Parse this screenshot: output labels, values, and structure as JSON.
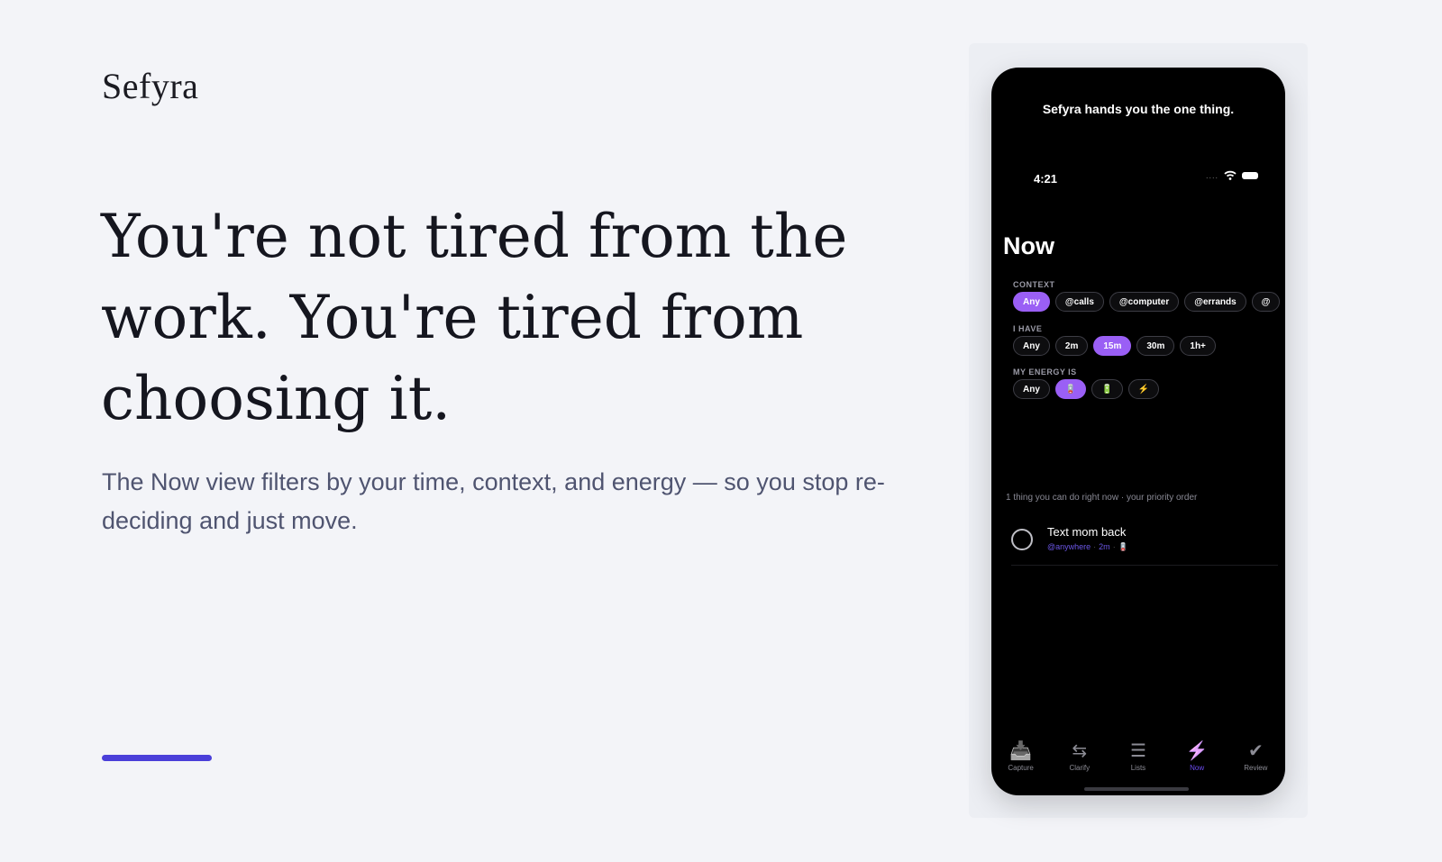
{
  "brand": "Sefyra",
  "headline": "You're not tired from the work. You're tired from choosing it.",
  "subtext": "The Now view filters by your time, context, and energy — so you stop re-deciding and just move.",
  "colors": {
    "accent": "#4a3fd9",
    "chip_active": "#9a5ff5",
    "tab_active": "#6b4bf0",
    "background": "#f3f4f8"
  },
  "phone": {
    "caption": "Sefyra hands you the one thing.",
    "time": "4:21",
    "status_icons": [
      "signal-dots-icon",
      "wifi-icon",
      "battery-icon"
    ],
    "title": "Now",
    "context": {
      "label": "CONTEXT",
      "chips": [
        "Any",
        "@calls",
        "@computer",
        "@errands",
        "@"
      ],
      "active": "Any"
    },
    "time_filter": {
      "label": "I HAVE",
      "chips": [
        "Any",
        "2m",
        "15m",
        "30m",
        "1h+"
      ],
      "active": "15m"
    },
    "energy": {
      "label": "MY ENERGY IS",
      "chips": [
        "Any",
        "🪫",
        "🔋",
        "⚡"
      ],
      "icons": [
        "low-battery-icon",
        "full-battery-icon",
        "lightning-icon"
      ],
      "active": "low"
    },
    "hint": "1 thing you can do right now · your priority order",
    "task": {
      "title": "Text mom back",
      "context": "@anywhere",
      "duration": "2m",
      "energy_icon": "low-battery-icon",
      "energy_glyph": "🪫"
    },
    "tabs": [
      {
        "label": "Capture",
        "icon": "inbox-icon",
        "glyph": "📥"
      },
      {
        "label": "Clarify",
        "icon": "swap-arrows-icon",
        "glyph": "⇆"
      },
      {
        "label": "Lists",
        "icon": "list-icon",
        "glyph": "☰"
      },
      {
        "label": "Now",
        "icon": "lightning-icon",
        "glyph": "⚡"
      },
      {
        "label": "Review",
        "icon": "check-circle-icon",
        "glyph": "✔"
      }
    ],
    "active_tab": "Now"
  }
}
